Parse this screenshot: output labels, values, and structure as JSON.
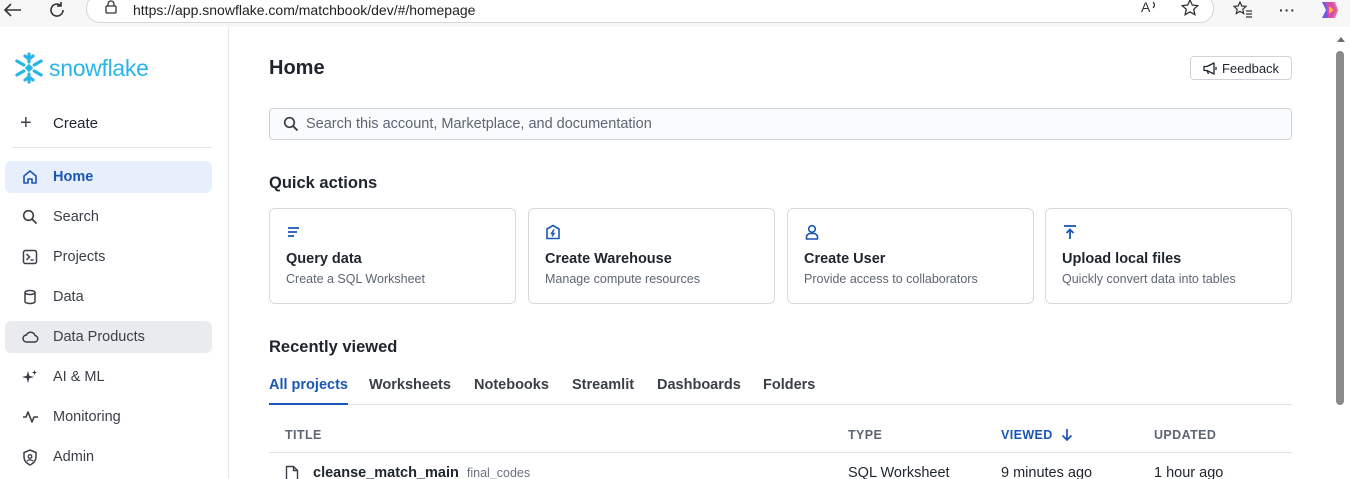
{
  "browser": {
    "url_host": "https://app.snowflake.com",
    "url_path": "/matchbook/dev/#/homepage"
  },
  "sidebar": {
    "logo_text": "snowflake",
    "create_label": "Create",
    "items": [
      {
        "label": "Home",
        "icon": "home-icon"
      },
      {
        "label": "Search",
        "icon": "search-icon"
      },
      {
        "label": "Projects",
        "icon": "terminal-icon"
      },
      {
        "label": "Data",
        "icon": "database-icon"
      },
      {
        "label": "Data Products",
        "icon": "cloud-icon"
      },
      {
        "label": "AI & ML",
        "icon": "sparkle-icon"
      },
      {
        "label": "Monitoring",
        "icon": "activity-icon"
      },
      {
        "label": "Admin",
        "icon": "shield-icon"
      }
    ]
  },
  "header": {
    "title": "Home",
    "feedback_label": "Feedback"
  },
  "search": {
    "placeholder": "Search this account, Marketplace, and documentation"
  },
  "quick_actions": {
    "title": "Quick actions",
    "cards": [
      {
        "title": "Query data",
        "desc": "Create a SQL Worksheet",
        "icon": "list-icon"
      },
      {
        "title": "Create Warehouse",
        "desc": "Manage compute resources",
        "icon": "warehouse-icon"
      },
      {
        "title": "Create User",
        "desc": "Provide access to collaborators",
        "icon": "user-icon"
      },
      {
        "title": "Upload local files",
        "desc": "Quickly convert data into tables",
        "icon": "upload-icon"
      }
    ]
  },
  "recent": {
    "title": "Recently viewed",
    "tabs": [
      "All projects",
      "Worksheets",
      "Notebooks",
      "Streamlit",
      "Dashboards",
      "Folders"
    ],
    "columns": [
      "TITLE",
      "TYPE",
      "VIEWED",
      "UPDATED"
    ],
    "rows": [
      {
        "title": "cleanse_match_main",
        "sub": "final_codes",
        "type": "SQL Worksheet",
        "viewed": "9 minutes ago",
        "updated": "1 hour ago"
      }
    ]
  },
  "colors": {
    "accent": "#1a56b4",
    "brand": "#29b5e8",
    "active_bg": "#e6effb"
  }
}
